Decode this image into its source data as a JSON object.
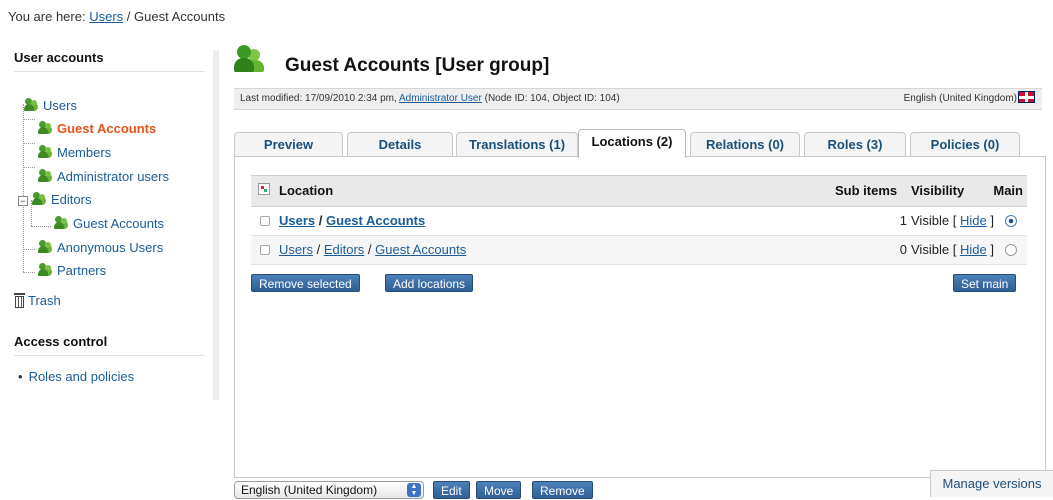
{
  "breadcrumb": {
    "prefix": "You are here:",
    "link": "Users",
    "separator": "/",
    "current": "Guest Accounts"
  },
  "sidebar": {
    "heading": "User accounts",
    "tree": [
      {
        "label": "Users",
        "active": false
      },
      {
        "label": "Guest Accounts",
        "active": true
      },
      {
        "label": "Members",
        "active": false
      },
      {
        "label": "Administrator users",
        "active": false
      },
      {
        "label": "Editors",
        "active": false,
        "expander": "−"
      },
      {
        "label": "Guest Accounts",
        "active": false
      },
      {
        "label": "Anonymous Users",
        "active": false
      },
      {
        "label": "Partners",
        "active": false
      }
    ],
    "trash_label": "Trash",
    "access_heading": "Access control",
    "access_link": "Roles and policies"
  },
  "header": {
    "title": "Guest Accounts [User group]",
    "modified_prefix": "Last modified: 17/09/2010 2:34 pm,",
    "modified_user": "Administrator User",
    "ids": "(Node ID: 104, Object ID: 104)",
    "language": "English (United Kingdom)"
  },
  "tabs": [
    {
      "label": "Preview",
      "active": false
    },
    {
      "label": "Details",
      "active": false
    },
    {
      "label": "Translations (1)",
      "active": false
    },
    {
      "label": "Locations (2)",
      "active": true
    },
    {
      "label": "Relations (0)",
      "active": false
    },
    {
      "label": "Roles (3)",
      "active": false
    },
    {
      "label": "Policies (0)",
      "active": false
    }
  ],
  "locations": {
    "columns": {
      "location": "Location",
      "sub_items": "Sub items",
      "visibility": "Visibility",
      "main": "Main"
    },
    "rows": [
      {
        "path": [
          "Users",
          "Guest Accounts"
        ],
        "sub_items": "1",
        "visibility": "Visible",
        "hide_link": "Hide",
        "main": true
      },
      {
        "path": [
          "Users",
          "Editors",
          "Guest Accounts"
        ],
        "sub_items": "0",
        "visibility": "Visible",
        "hide_link": "Hide",
        "main": false
      }
    ],
    "bracket_open": "[",
    "bracket_close": "]",
    "path_sep": "/",
    "buttons": {
      "remove_selected": "Remove selected",
      "add_locations": "Add locations",
      "set_main": "Set main"
    }
  },
  "footer": {
    "language_select": "English (United Kingdom)",
    "edit": "Edit",
    "move": "Move",
    "remove": "Remove",
    "manage_versions": "Manage versions"
  },
  "colors": {
    "accent": "#2f5e94",
    "link": "#1a5c9a",
    "active_tree": "#e8531a"
  }
}
